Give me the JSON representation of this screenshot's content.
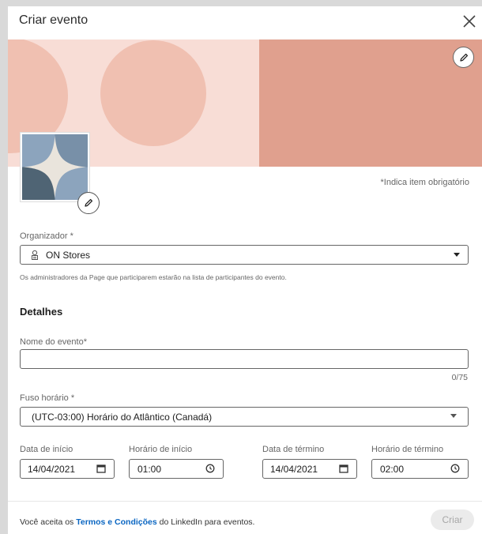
{
  "modal": {
    "title": "Criar evento",
    "required_note": "*Indica item obrigatório"
  },
  "colors": {
    "cover_left": "#f8ddd6",
    "cover_circle": "#f0c0b1",
    "cover_right": "#e0a08e",
    "link": "#0a66c2",
    "logo_dark": "#4f6474",
    "logo_light": "#8ca4bd"
  },
  "organizer": {
    "label": "Organizador",
    "required_mark": "*",
    "value": "ON Stores",
    "icon": "company-icon",
    "hint": "Os administradores da Page que participarem estarão na lista de participantes do evento."
  },
  "details": {
    "heading": "Detalhes",
    "event_name_label": "Nome do evento",
    "event_name_required_mark": "*",
    "event_name_value": "",
    "event_name_counter": "0/75",
    "timezone_label": "Fuso horário",
    "timezone_required_mark": "*",
    "timezone_value": "(UTC-03:00) Horário do Atlântico (Canadá)",
    "start_date_label": "Data de início",
    "start_date_value": "14/04/2021",
    "start_time_label": "Horário de início",
    "start_time_value": "01:00",
    "end_date_label": "Data de término",
    "end_date_value": "14/04/2021",
    "end_time_label": "Horário de término",
    "end_time_value": "02:00"
  },
  "footer": {
    "text_before": "Você aceita os ",
    "terms_link": "Termos e Condições",
    "text_after": " do LinkedIn para eventos.",
    "create_button": "Criar"
  }
}
